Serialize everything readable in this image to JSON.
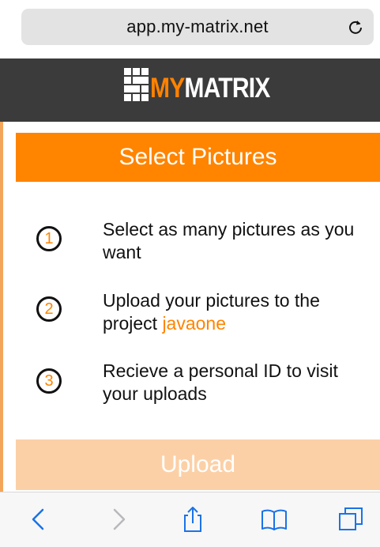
{
  "browser": {
    "url": "app.my-matrix.net",
    "reload_icon": "reload-icon"
  },
  "brand": {
    "logo_my": "MY",
    "logo_matrix": "MATRIX",
    "logo_icon": "grid-logo-icon",
    "accent_color": "#ff8200"
  },
  "page": {
    "title": "Select Pictures",
    "steps": [
      {
        "number": "1",
        "text": "Select as many pictures as you want"
      },
      {
        "number": "2",
        "text_prefix": "Upload your pictures to the project ",
        "project": "javaone"
      },
      {
        "number": "3",
        "text": "Recieve a personal ID to visit your uploads"
      }
    ],
    "upload_label": "Upload"
  },
  "toolbar": {
    "items": [
      "back-icon",
      "forward-icon",
      "share-icon",
      "bookmarks-icon",
      "tabs-icon"
    ]
  }
}
